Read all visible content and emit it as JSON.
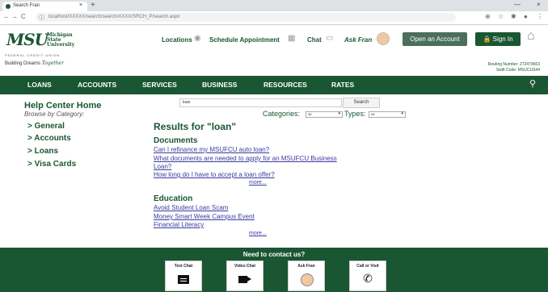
{
  "browser": {
    "tab_title": "Search Fran",
    "tab_close": "×",
    "new_tab": "+",
    "back": "←",
    "forward": "→",
    "reload": "C",
    "lock": "ⓘ",
    "url": "localhost/XXXXX/search/search/XXXX/SRCH_P/search.aspx",
    "minimize": "—",
    "close": "×"
  },
  "header": {
    "logo_text": "MSU",
    "logo_words": [
      "Michigan",
      "State",
      "University"
    ],
    "logo_fcu": "FEDERAL CREDIT UNION",
    "tagline_prefix": "Building Dreams",
    "tagline_script": "Together",
    "locations": "Locations",
    "schedule": "Schedule Appointment",
    "chat": "Chat",
    "ask_fran": "Ask Fran",
    "open_account": "Open an Account",
    "sign_in": "Sign In",
    "routing_number": "Routing Number: 272479663",
    "swift_code": "Swift Code: MSUCUS44"
  },
  "nav": {
    "items": [
      "LOANS",
      "ACCOUNTS",
      "SERVICES",
      "BUSINESS",
      "RESOURCES",
      "RATES"
    ]
  },
  "sidebar": {
    "title": "Help Center Home",
    "subtitle": "Browse by Category:",
    "categories": [
      "> General",
      "> Accounts",
      "> Loans",
      "> Visa Cards"
    ]
  },
  "search": {
    "value": "loan",
    "button": "Search",
    "categories_label": "Categories:",
    "categories_value": "All",
    "types_label": "Types:",
    "types_value": "All"
  },
  "results": {
    "heading": "Results for \"loan\"",
    "documents_heading": "Documents",
    "documents": [
      "Can I refinance my MSUFCU auto loan?",
      "What documents are needed to apply for an MSUFCU Business",
      "Loan?",
      "How long do I have to accept a loan offer?"
    ],
    "more_label": "more...",
    "education_heading": "Education",
    "education": [
      "Avoid Student Loan Scam",
      "Money Smart Week Campus Event",
      "Financial Literacy"
    ]
  },
  "footer": {
    "heading": "Need to contact us?",
    "cards": [
      "Text Chat",
      "Video Chat",
      "Ask Fran",
      "Call or Visit"
    ]
  },
  "colors": {
    "brand_green": "#1a5632",
    "link": "#3a3aa0"
  }
}
